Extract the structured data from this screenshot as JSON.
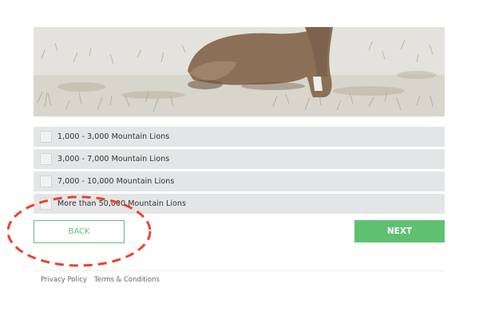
{
  "options": [
    {
      "label": "1,000 - 3,000 Mountain Lions"
    },
    {
      "label": "3,000 - 7,000 Mountain Lions"
    },
    {
      "label": "7,000 - 10,000 Mountain Lions"
    },
    {
      "label": "More than 50,000 Mountain Lions"
    }
  ],
  "buttons": {
    "back_label": "BACK",
    "next_label": "NEXT"
  },
  "footer": {
    "privacy_label": "Privacy Policy",
    "terms_label": "Terms & Conditions"
  },
  "colors": {
    "accent": "#5fc072",
    "annotation": "#e8442a",
    "option_bg": "#e4e5e6"
  }
}
